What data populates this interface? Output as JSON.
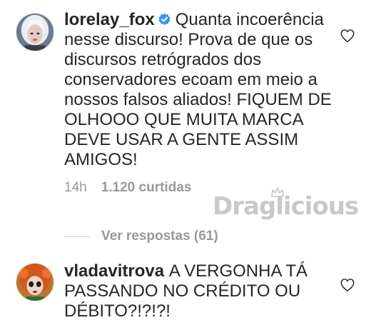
{
  "comments": [
    {
      "username": "lorelay_fox",
      "verified": true,
      "text": "Quanta incoerência nesse discurso! Prova de que os discursos retrógrados dos conservadores ecoam em meio a nossos falsos aliados! FIQUEM DE OLHOOO QUE MUITA MARCA DEVE USAR A GENTE ASSIM AMIGOS!",
      "time": "14h",
      "likes": "1.120 curtidas",
      "replies": "Ver respostas (61)"
    },
    {
      "username": "vladavitrova",
      "verified": false,
      "text": "A VERGONHA TÁ PASSANDO NO CRÉDITO OU DÉBITO?!?!?!"
    }
  ],
  "watermark": "Draglicious",
  "icons": {
    "like": "heart-outline-icon",
    "verified": "verified-badge-icon"
  },
  "colors": {
    "text": "#262626",
    "meta": "#999999",
    "verified_blue": "#3897f0",
    "watermark": "#c8c8c8"
  }
}
